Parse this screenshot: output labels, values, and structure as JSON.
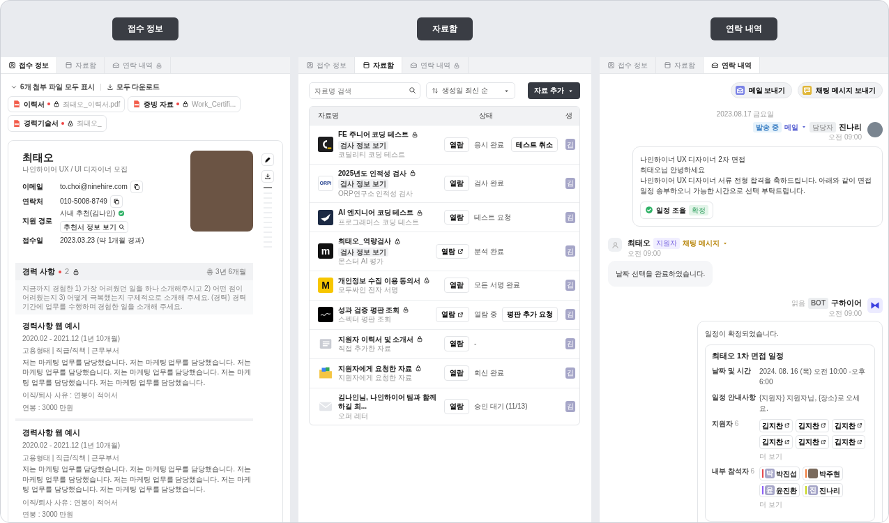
{
  "section_labels": [
    "접수 정보",
    "자료함",
    "연락 내역"
  ],
  "application_panel": {
    "tabs": [
      {
        "label": "접수 정보",
        "locked": false,
        "selected": true
      },
      {
        "label": "자료함",
        "locked": false,
        "selected": false
      },
      {
        "label": "연락 내역",
        "locked": true,
        "selected": false
      }
    ],
    "attachments_toggle": "6개 첨부 파일 모두 표시",
    "download_all": "모두 다운로드",
    "files": [
      {
        "type": "이력서",
        "required": true,
        "locked": true,
        "filename": "최태오_이력서.pdf"
      },
      {
        "type": "증빙 자료",
        "required": true,
        "locked": true,
        "filename": "Work_Certifi..."
      },
      {
        "type": "경력기술서",
        "required": true,
        "locked": true,
        "filename": "최태오_"
      }
    ],
    "profile": {
      "name": "최태오",
      "position": "나인하이어 UX / UI 디자이너 모집",
      "fields": [
        {
          "kind": "copy",
          "label": "이메일",
          "value": "to.choi@ninehire.com"
        },
        {
          "kind": "copy",
          "label": "연락처",
          "value": "010-5008-8749"
        },
        {
          "kind": "referral",
          "label": "지원 경로",
          "value": "사내 추천(김나인)",
          "verified": true,
          "button": "추천서 정보 보기"
        },
        {
          "kind": "plain",
          "label": "접수일",
          "value": "2023.03.23 (약 1개월 경과)"
        }
      ]
    },
    "experience": {
      "title": "경력 사항",
      "required": true,
      "count": "2",
      "locked": true,
      "total": "총 3년 6개월",
      "instructions": "지금까지 경험한 1) 가장 어려웠던 일을 하나 소개해주시고 2) 어떤 점이 어려웠는지 3) 어떻게 극복했는지 구체적으로 소개해 주세요. (경력) 경력 기간에 업무를 수행하며 경험한 일을 소개해 주세요.",
      "entries": [
        {
          "title": "경력사항 웹 예시",
          "period": "2020.02 - 2021.12 (1년 10개월)",
          "details": "고용형태 | 직급/직책 | 근무부서",
          "description": "저는 마케팅 업무를 담당했습니다. 저는 마케팅 업무를 담당했습니다. 저는 마케팅 업무를 담당했습니다. 저는 마케팅 업무를 담당했습니다. 저는 마케팅 업무를 담당했습니다. 저는 마케팅 업무를 담당했습니다.",
          "reason": "이직/퇴사 사유 : 연봉이 적어서",
          "salary": "연봉 : 3000 만원"
        },
        {
          "title": "경력사항 웹 예시",
          "period": "2020.02 - 2021.12 (1년 10개월)",
          "details": "고용형태 | 직급/직책 | 근무부서",
          "description": "저는 마케팅 업무를 담당했습니다. 저는 마케팅 업무를 담당했습니다. 저는 마케팅 업무를 담당했습니다. 저는 마케팅 업무를 담당했습니다. 저는 마케팅 업무를 담당했습니다. 저는 마케팅 업무를 담당했습니다.",
          "reason": "이직/퇴사 사유 : 연봉이 적어서",
          "salary": "연봉 : 3000 만원"
        }
      ]
    }
  },
  "files_panel": {
    "tabs": [
      {
        "label": "접수 정보",
        "locked": false,
        "selected": false
      },
      {
        "label": "자료함",
        "locked": false,
        "selected": true
      },
      {
        "label": "연락 내역",
        "locked": true,
        "selected": false
      }
    ],
    "search_placeholder": "자료명 검색",
    "sort": "생성일 최신 순",
    "add_button": "자료 추가",
    "columns": [
      "자료명",
      "상태",
      "생"
    ],
    "rows": [
      {
        "title": "FE 주니어 코딩 테스트",
        "locked": true,
        "badge": "검사 정보 보기",
        "subtitle": "코딜리티 코딩 테스트",
        "open": "열람",
        "external": false,
        "status": "응시 완료",
        "action": "테스트 취소",
        "creator": "김"
      },
      {
        "logo_text": "ORPi",
        "title": "2025년도 인적성 검사",
        "locked": true,
        "badge": "검사 정보 보기",
        "subtitle": "ORP연구소 인적성 검사",
        "open": "열람",
        "external": false,
        "status": "검사 완료",
        "creator": "김"
      },
      {
        "title": "AI 엔지니어 코딩 테스트",
        "locked": true,
        "subtitle": "프로그래머스 코딩 테스트",
        "open": "열람",
        "external": false,
        "status": "테스트 요청",
        "creator": "김"
      },
      {
        "logo_text": "m",
        "title": "최태오_역량검사",
        "locked": true,
        "badge": "검사 정보 보기",
        "subtitle": "몬스터 AI 평가",
        "open": "열람",
        "external": true,
        "status": "분석 완료",
        "creator": "김"
      },
      {
        "logo_text": "M",
        "title": "개인정보 수집 이용 동의서",
        "locked": true,
        "subtitle": "모두싸인 전자 서명",
        "open": "열람",
        "external": false,
        "status": "모든 서명 완료",
        "creator": "김"
      },
      {
        "title": "성과 검증 평판 조회",
        "locked": true,
        "subtitle": "스펙터 평판 조회",
        "open": "열람",
        "external": true,
        "status": "열람 중",
        "action": "평판 추가 요청",
        "creator": "김"
      },
      {
        "title": "지원자 이력서 및 소개서",
        "locked": true,
        "subtitle": "직접 추가한 자료",
        "open": "열람",
        "external": false,
        "status": "-",
        "creator": "김"
      },
      {
        "title": "지원자에게 요청한 자료",
        "locked": true,
        "subtitle": "지원자에게 요청한 자료",
        "open": "열람",
        "external": false,
        "status": "회신 완료",
        "creator": "김"
      },
      {
        "title": "김나인님, 나인하이어 팀과 함께하길 희...",
        "locked": false,
        "subtitle": "오퍼 레터",
        "open": "열람",
        "external": false,
        "status": "승인 대기 (11/13)",
        "creator": "김"
      }
    ]
  },
  "contact_panel": {
    "tabs": [
      {
        "label": "접수 정보",
        "locked": false,
        "selected": false
      },
      {
        "label": "자료함",
        "locked": false,
        "selected": false
      },
      {
        "label": "연락 내역",
        "locked": false,
        "selected": true
      }
    ],
    "buttons": [
      "메일 보내기",
      "채팅 메시지 보내기"
    ],
    "date": "2023.08.17 금요일",
    "messages": [
      {
        "kind": "outgoing",
        "status_tag": "발송 중",
        "channel": "메일",
        "role_tag": "담당자",
        "sender": "진나리",
        "time": "오전 09:00",
        "lines": [
          "나인하이너 UX 디자이너 2차 면접",
          "최태오님 안녕하세요",
          "나인하이어 UX 디자이너 서류 전형 합격을 축하드립니다. 아래와 같이 면접 일정 송부하오니 가능한 시간으로 선택 부탁드립니다."
        ],
        "chip": {
          "label": "일정 조율",
          "tag": "확정"
        }
      },
      {
        "kind": "incoming",
        "sender": "최태오",
        "role_tag": "지원자",
        "channel": "채팅 메시지",
        "time": "오전 09:00",
        "lines": [
          "날짜 선택을 완료하였습니다."
        ]
      },
      {
        "kind": "bot",
        "read": "읽음",
        "role_tag": "BOT",
        "sender": "구하이어",
        "time": "오전 09:00",
        "lines": [
          "일정이 확정되었습니다."
        ],
        "card": {
          "title": "최태오 1차 면접 일정",
          "rows": [
            {
              "kind": "text",
              "label": "날짜 및 시간",
              "value": "2024. 08. 16 (목) 오전 10:00 -오후 6:00"
            },
            {
              "kind": "text",
              "label": "일정 안내사항",
              "value": "{지원자} 지원자님, {장소}로 오세요."
            },
            {
              "kind": "applicants",
              "label": "지원자",
              "count": "6",
              "items": [
                {
                  "name": "김지찬"
                },
                {
                  "name": "김지찬"
                },
                {
                  "name": "김지찬"
                },
                {
                  "name": "김지찬"
                },
                {
                  "name": "김지찬"
                },
                {
                  "name": "김지찬"
                }
              ],
              "more": "더 보기"
            },
            {
              "kind": "people",
              "label": "내부 참석자",
              "count": "6",
              "items": [
                {
                  "name": "박진섭",
                  "initial": "박",
                  "color": "#e5484d"
                },
                {
                  "name": "박주현",
                  "color": "#f07a3a"
                },
                {
                  "name": "윤진환",
                  "initial": "윤",
                  "color": "#8b5cf6"
                },
                {
                  "name": "진나리",
                  "initial": "진",
                  "color": "#c6d61c"
                }
              ],
              "more": "더 보기"
            }
          ]
        }
      }
    ]
  }
}
